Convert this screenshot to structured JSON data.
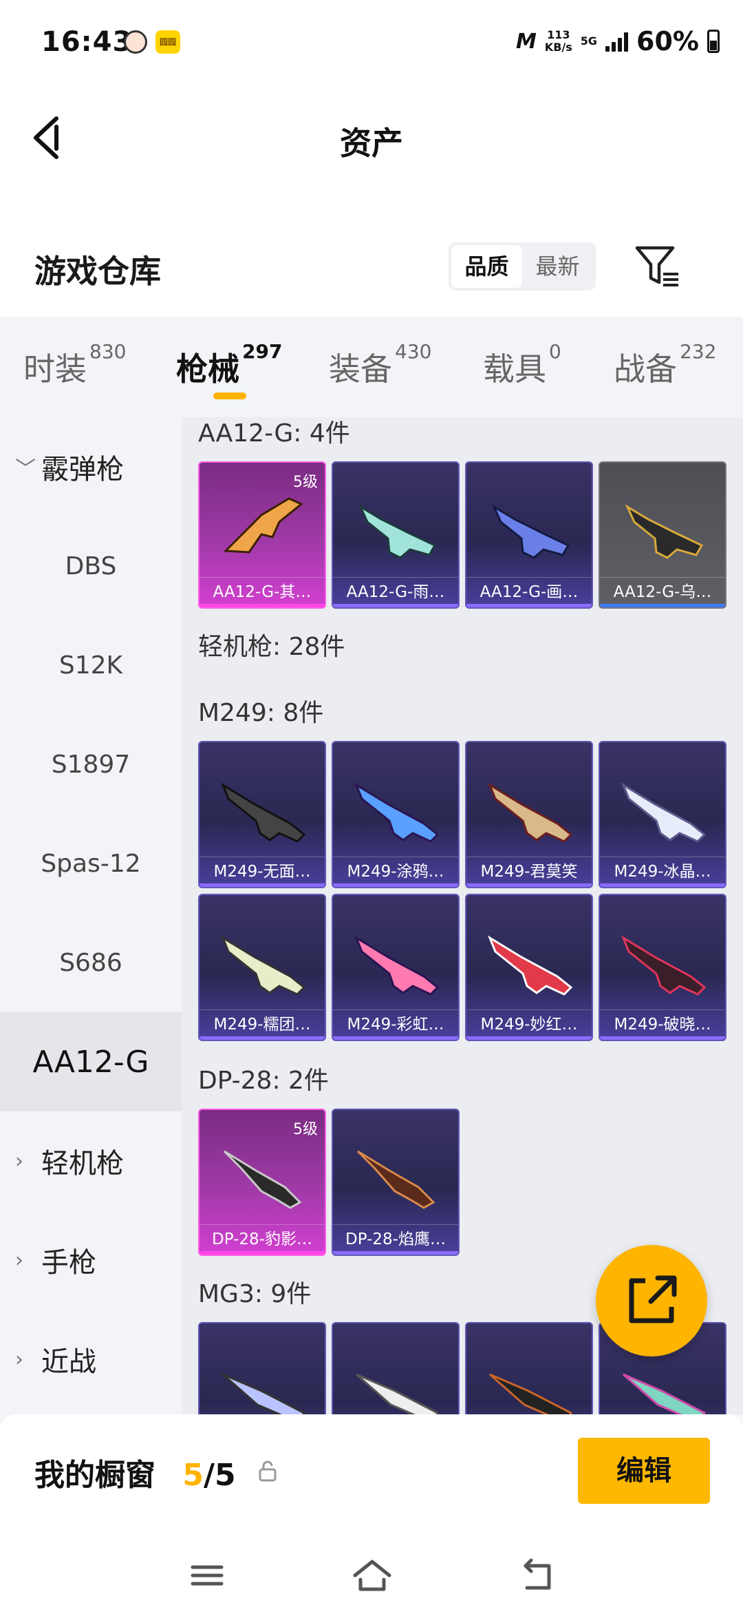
{
  "status_bar": {
    "time": "16:43",
    "app_badge": "园园",
    "speed_value": "113",
    "speed_unit": "KB/s",
    "network": "5G",
    "battery": "60%"
  },
  "header": {
    "title": "资产"
  },
  "section": {
    "title": "游戏仓库",
    "sort_quality": "品质",
    "sort_newest": "最新"
  },
  "tabs": [
    {
      "label": "时装",
      "count": "830"
    },
    {
      "label": "枪械",
      "count": "297"
    },
    {
      "label": "装备",
      "count": "430"
    },
    {
      "label": "载具",
      "count": "0"
    },
    {
      "label": "战备",
      "count": "232"
    }
  ],
  "sidebar": {
    "shotgun": "霰弹枪",
    "dbs": "DBS",
    "s12k": "S12K",
    "s1897": "S1897",
    "spas12": "Spas-12",
    "s686": "S686",
    "aa12g": "AA12-G",
    "lmg": "轻机枪",
    "pistol": "手枪",
    "melee": "近战"
  },
  "content": {
    "aa12_header": "AA12-G: 4件",
    "aa12_items": [
      "AA12-G-其…",
      "AA12-G-雨…",
      "AA12-G-画…",
      "AA12-G-乌…"
    ],
    "aa12_level": "5级",
    "lmg_header": "轻机枪: 28件",
    "m249_header": "M249: 8件",
    "m249_items": [
      "M249-无面…",
      "M249-涂鸦…",
      "M249-君莫笑",
      "M249-冰晶…",
      "M249-糯团…",
      "M249-彩虹…",
      "M249-妙红…",
      "M249-破晓…"
    ],
    "dp28_header": "DP-28: 2件",
    "dp28_items": [
      "DP-28-豹影…",
      "DP-28-焰鹰…"
    ],
    "dp28_level": "5级",
    "mg3_header": "MG3: 9件"
  },
  "showcase": {
    "label": "我的橱窗",
    "current": "5",
    "total": "/5",
    "edit": "编辑"
  },
  "colors": {
    "accent": "#ffb400",
    "rare": "#ff46e6",
    "epic": "#6257b8"
  },
  "icons": [
    "back-arrow-icon",
    "filter-icon",
    "share-icon",
    "lock-icon",
    "menu-icon",
    "home-icon",
    "return-icon"
  ]
}
